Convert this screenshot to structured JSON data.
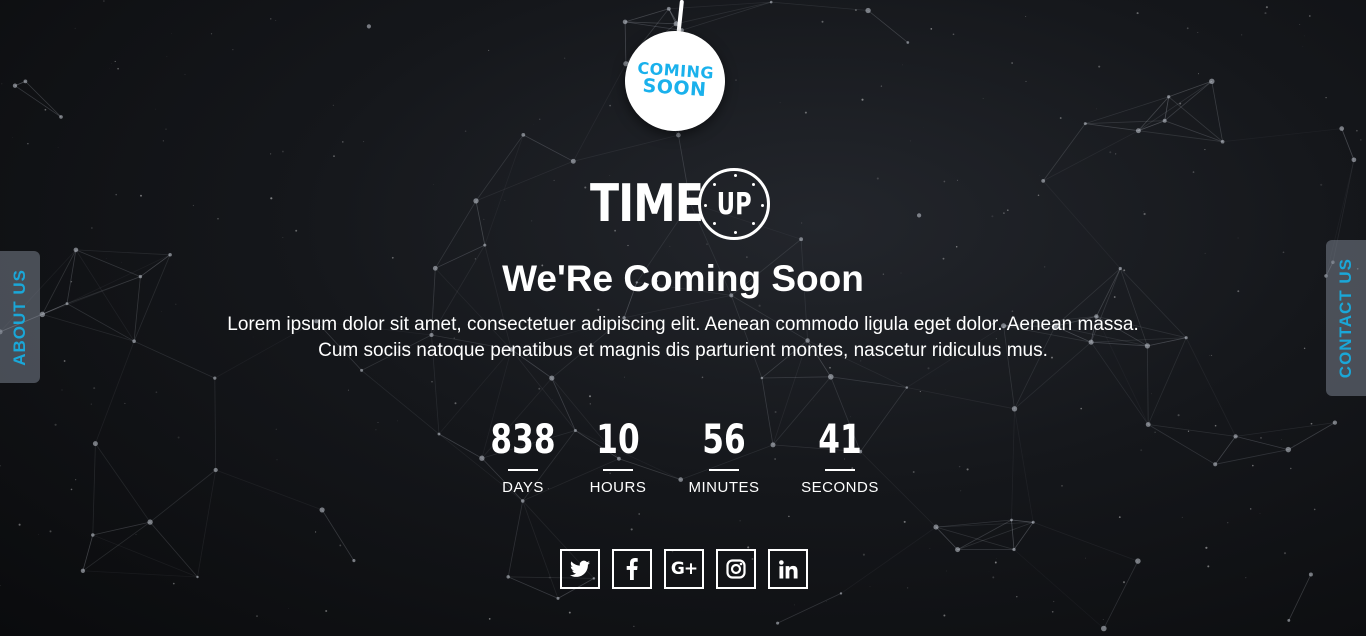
{
  "badge": {
    "line1": "COMING",
    "line2": "SOON"
  },
  "logo": {
    "word": "TIME",
    "clock_text": "UP"
  },
  "headline": "We'Re Coming Soon",
  "description": "Lorem ipsum dolor sit amet, consectetuer adipiscing elit. Aenean commodo ligula eget dolor. Aenean massa. Cum sociis natoque penatibus et magnis dis parturient montes, nascetur ridiculus mus.",
  "countdown": [
    {
      "value": "838",
      "label": "DAYS"
    },
    {
      "value": "10",
      "label": "HOURS"
    },
    {
      "value": "56",
      "label": "MINUTES"
    },
    {
      "value": "41",
      "label": "SECONDS"
    }
  ],
  "social": [
    {
      "icon": "twitter-icon"
    },
    {
      "icon": "facebook-icon"
    },
    {
      "icon": "google-plus-icon",
      "text": "G+"
    },
    {
      "icon": "instagram-icon"
    },
    {
      "icon": "linkedin-icon"
    }
  ],
  "side_tabs": {
    "left": "ABOUT US",
    "right": "CONTACT US"
  },
  "colors": {
    "accent": "#1ab1ec",
    "background": "#15171b",
    "text": "#ffffff",
    "tab_background": "#78808c"
  }
}
